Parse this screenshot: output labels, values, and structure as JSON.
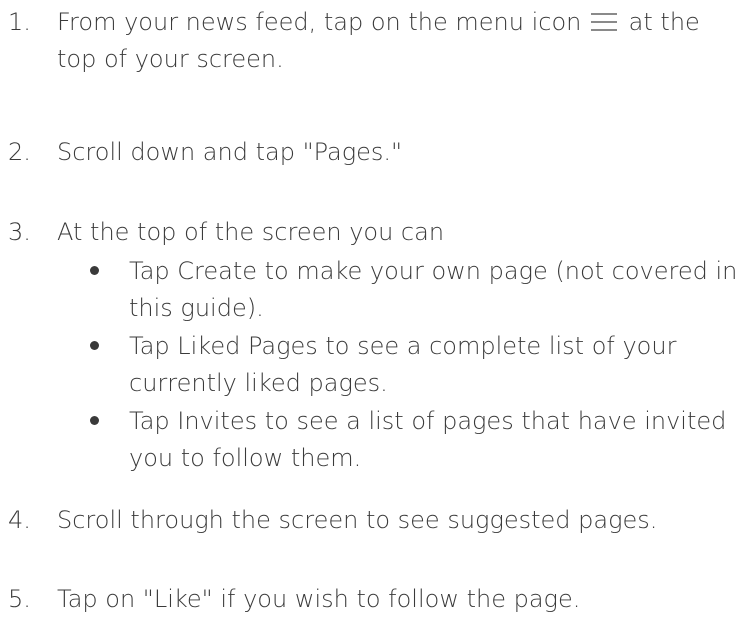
{
  "steps": [
    {
      "number": "1.",
      "line1_before": "From your news feed, tap on the menu icon",
      "line1_after": "at the",
      "line2": "top of your screen.",
      "icon": "hamburger-menu-icon"
    },
    {
      "number": "2.",
      "text": "Scroll down and tap \"Pages.\""
    },
    {
      "number": "3.",
      "text": "At the top of the screen you can",
      "bullets": [
        {
          "line1": "Tap Create to make your own page (not covered in",
          "line2": "this guide)."
        },
        {
          "line1": "Tap Liked Pages to see a complete list of your",
          "line2": "currently liked pages."
        },
        {
          "line1": "Tap Invites to see a list of pages that have invited",
          "line2": "you to follow them."
        }
      ]
    },
    {
      "number": "4.",
      "text": "Scroll through the screen to see suggested pages."
    },
    {
      "number": "5.",
      "text": "Tap on \"Like\" if you wish to follow the page."
    }
  ],
  "colors": {
    "text": "#3a3a3a",
    "icon": "#8a8a8a"
  }
}
